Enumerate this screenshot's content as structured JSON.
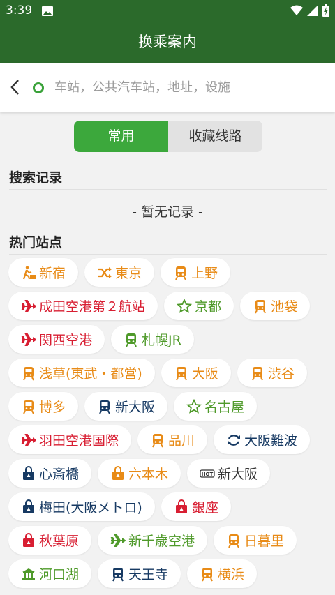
{
  "status": {
    "time": "3:39"
  },
  "header": {
    "title": "换乘案内"
  },
  "search": {
    "placeholder": "车站，公共汽车站，地址，设施"
  },
  "tabs": [
    {
      "label": "常用",
      "active": true
    },
    {
      "label": "收藏线路",
      "active": false
    }
  ],
  "history": {
    "title": "搜索记录",
    "empty_text": "- 暂无记录 -"
  },
  "hot": {
    "title": "热门站点",
    "rows": [
      [
        {
          "label": "新宿",
          "icon": "walking-person-icon",
          "color": "orange"
        },
        {
          "label": "東京",
          "icon": "shuffle-icon",
          "color": "orange"
        },
        {
          "label": "上野",
          "icon": "train-icon",
          "color": "orange"
        }
      ],
      [
        {
          "label": "成田空港第２航站",
          "icon": "airplane-icon",
          "color": "red"
        },
        {
          "label": "京都",
          "icon": "star-outline-icon",
          "color": "green"
        },
        {
          "label": "池袋",
          "icon": "train-icon",
          "color": "orange"
        }
      ],
      [
        {
          "label": "関西空港",
          "icon": "airplane-icon",
          "color": "red"
        },
        {
          "label": "札幌JR",
          "icon": "train-icon",
          "color": "green"
        }
      ],
      [
        {
          "label": "浅草(東武・都営)",
          "icon": "train-icon",
          "color": "orange"
        },
        {
          "label": "大阪",
          "icon": "train-icon",
          "color": "orange"
        },
        {
          "label": "渋谷",
          "icon": "train-icon",
          "color": "orange"
        }
      ],
      [
        {
          "label": "博多",
          "icon": "train-icon",
          "color": "orange"
        },
        {
          "label": "新大阪",
          "icon": "train-icon",
          "color": "navy"
        },
        {
          "label": "名古屋",
          "icon": "star-outline-icon",
          "color": "green"
        }
      ],
      [
        {
          "label": "羽田空港国際",
          "icon": "airplane-icon",
          "color": "red"
        },
        {
          "label": "品川",
          "icon": "train-icon",
          "color": "orange"
        },
        {
          "label": "大阪難波",
          "icon": "refresh-icon",
          "color": "navy"
        }
      ],
      [
        {
          "label": "心斎橋",
          "icon": "shopping-bag-icon",
          "color": "navy"
        },
        {
          "label": "六本木",
          "icon": "shopping-bag-icon",
          "color": "orange"
        },
        {
          "label": "新大阪",
          "icon": "hot-badge-icon",
          "color": "dark"
        }
      ],
      [
        {
          "label": "梅田(大阪メトロ)",
          "icon": "shopping-bag-icon",
          "color": "navy"
        },
        {
          "label": "銀座",
          "icon": "shopping-bag-icon",
          "color": "red"
        }
      ],
      [
        {
          "label": "秋葉原",
          "icon": "shopping-bag-icon",
          "color": "red"
        },
        {
          "label": "新千歳空港",
          "icon": "airplane-icon",
          "color": "green"
        },
        {
          "label": "日暮里",
          "icon": "train-icon",
          "color": "orange"
        }
      ],
      [
        {
          "label": "河口湖",
          "icon": "temple-icon",
          "color": "green"
        },
        {
          "label": "天王寺",
          "icon": "train-icon",
          "color": "navy"
        },
        {
          "label": "横浜",
          "icon": "train-icon",
          "color": "orange"
        }
      ]
    ]
  },
  "colors": {
    "header_bg": "#2b6a2b",
    "tab_active": "#3ca83c",
    "orange": "#e88b17",
    "red": "#d81e32",
    "green": "#4f9a2a",
    "navy": "#173a63",
    "dark": "#333333"
  }
}
